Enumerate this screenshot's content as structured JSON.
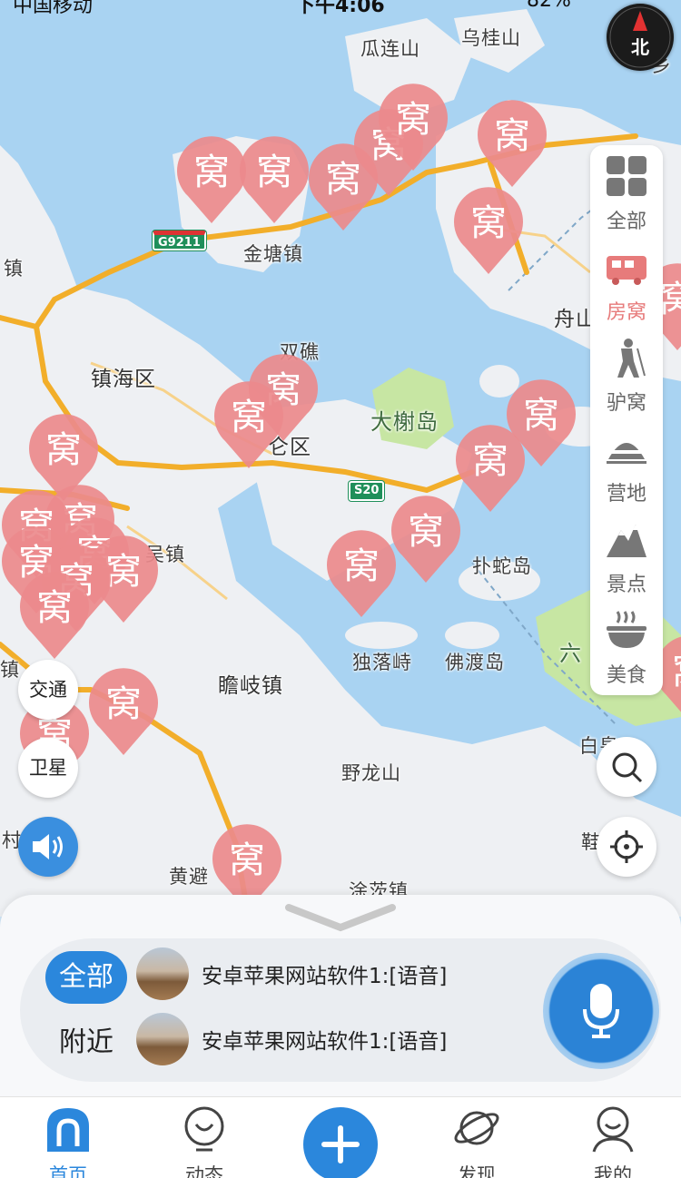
{
  "status_bar": {
    "carrier": "中国移动",
    "time": "下午4:06",
    "battery": "82%"
  },
  "compass": {
    "label": "北"
  },
  "map": {
    "marker_label": "窝",
    "places": {
      "guaLianShan": "瓜连山",
      "wuGuiShan": "乌桂山",
      "jinTangZhen": "金塘镇",
      "zhenLeft": "镇",
      "shuangJiao": "双礁",
      "zhenHaiQu": "镇海区",
      "daXieDao": "大榭岛",
      "lunQu": "仑区",
      "zhouShan": "舟山",
      "puTuoDao": "扑蛇岛",
      "wuZhen": "吴镇",
      "zhanQiZhen": "瞻岐镇",
      "duLuoShi": "独落峙",
      "foDuDao": "佛渡岛",
      "liu": "六",
      "baiQuan": "白泉",
      "yeLongShan": "野龙山",
      "huangBi": "黄避",
      "tuChaZhen": "涂茨镇",
      "qianZhen": "鞋",
      "cun": "村",
      "xiang": "乡",
      "zhenLeft2": "镇"
    },
    "roads": {
      "g9211": "G9211",
      "s20": "S20"
    }
  },
  "categories": [
    {
      "label": "全部",
      "icon": "grid-icon",
      "active": false
    },
    {
      "label": "房窝",
      "icon": "rv-icon",
      "active": true
    },
    {
      "label": "驴窝",
      "icon": "hiker-icon",
      "active": false
    },
    {
      "label": "营地",
      "icon": "tent-icon",
      "active": false
    },
    {
      "label": "景点",
      "icon": "mountain-icon",
      "active": false
    },
    {
      "label": "美食",
      "icon": "bowl-icon",
      "active": false
    }
  ],
  "map_toggles": {
    "traffic": "交通",
    "satellite": "卫星"
  },
  "feed": {
    "tabs": [
      "全部",
      "附近"
    ],
    "items": [
      {
        "text": "安卓苹果网站软件1:[语音]"
      },
      {
        "text": "安卓苹果网站软件1:[语音]"
      }
    ]
  },
  "nav": {
    "items": [
      {
        "label": "首页",
        "icon": "home-icon",
        "active": true
      },
      {
        "label": "动态",
        "icon": "dynamic-icon",
        "active": false
      },
      {
        "label": "发现",
        "icon": "planet-icon",
        "active": false
      },
      {
        "label": "我的",
        "icon": "profile-icon",
        "active": false
      }
    ]
  },
  "colors": {
    "accent": "#2b87dc",
    "marker": "#ec8a8c",
    "road": "#f2ae2a",
    "water": "#a9d3f2",
    "land": "#eef0f3"
  }
}
